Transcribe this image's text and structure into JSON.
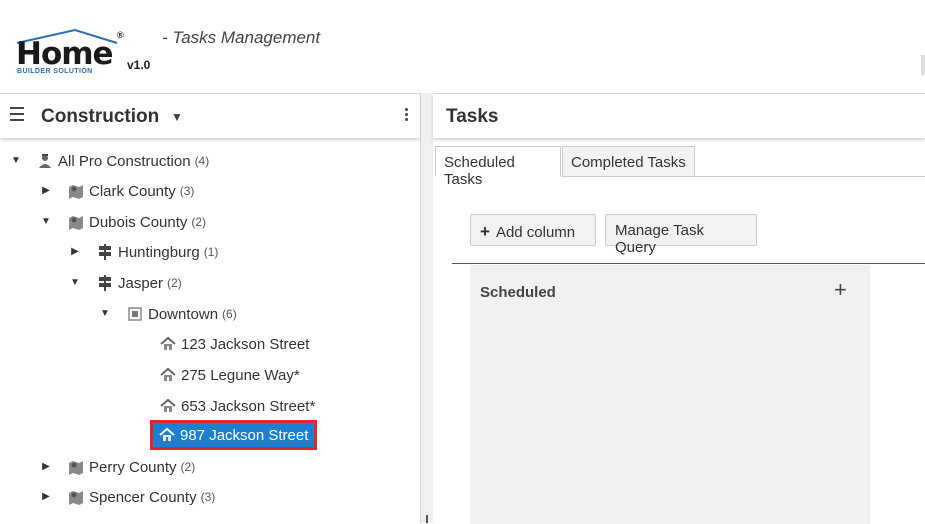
{
  "header": {
    "logo_word": "Home",
    "logo_reg": "®",
    "logo_sub": "BUILDER SOLUTION",
    "logo_version": "v1.0",
    "subtitle": "- Tasks Management"
  },
  "left_panel": {
    "title": "Construction",
    "caret": "▼"
  },
  "tree": {
    "root": {
      "label": "All Pro Construction",
      "count": "(4)"
    },
    "clark": {
      "label": "Clark County",
      "count": "(3)"
    },
    "dubois": {
      "label": "Dubois County",
      "count": "(2)"
    },
    "huntingburg": {
      "label": "Huntingburg",
      "count": "(1)"
    },
    "jasper": {
      "label": "Jasper",
      "count": "(2)"
    },
    "downtown": {
      "label": "Downtown",
      "count": "(6)"
    },
    "lot1": {
      "label": "123 Jackson Street"
    },
    "lot2": {
      "label": "275 Legune Way*"
    },
    "lot3": {
      "label": "653 Jackson Street*"
    },
    "lot4": {
      "label": "987 Jackson Street"
    },
    "perry": {
      "label": "Perry County",
      "count": "(2)"
    },
    "spencer": {
      "label": "Spencer County",
      "count": "(3)"
    }
  },
  "right_panel": {
    "title": "Tasks",
    "tabs": [
      {
        "label": "Scheduled Tasks"
      },
      {
        "label": "Completed Tasks"
      }
    ],
    "add_column": "Add column",
    "add_column_icon": "+",
    "manage_query": "Manage Task Query",
    "column_title": "Scheduled",
    "column_add": "+"
  },
  "colors": {
    "selected_bg": "#1c7fd0",
    "selected_outline": "#e0262b",
    "logo_accent": "#2a6fb4"
  },
  "icons": {
    "root": "person-icon",
    "county": "map-icon",
    "city": "signpost-icon",
    "subdivision": "block-icon",
    "lot": "house-icon",
    "expanded": "triangle-down-icon",
    "collapsed": "triangle-right-icon"
  }
}
